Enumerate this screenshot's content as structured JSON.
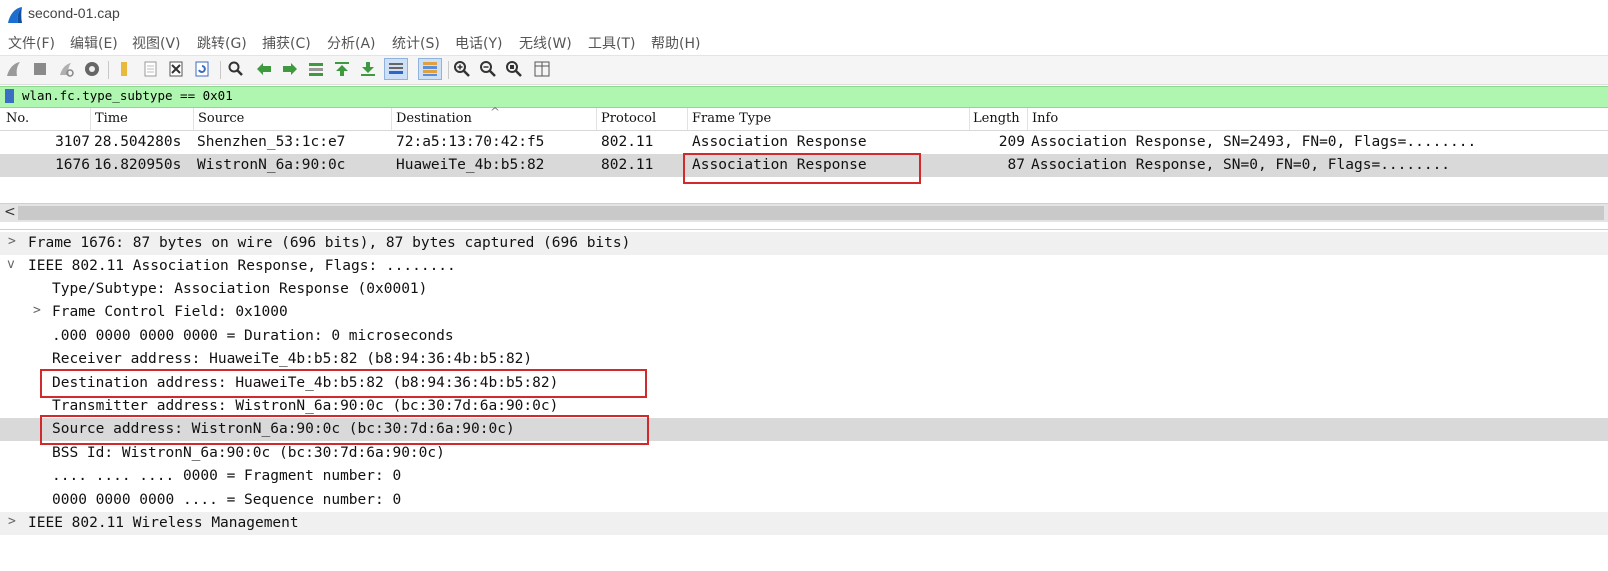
{
  "window": {
    "title": "second-01.cap"
  },
  "menu": [
    "文件(F)",
    "编辑(E)",
    "视图(V)",
    "跳转(G)",
    "捕获(C)",
    "分析(A)",
    "统计(S)",
    "电话(Y)",
    "无线(W)",
    "工具(T)",
    "帮助(H)"
  ],
  "toolbar": {
    "buttons": [
      "start-capture-icon",
      "stop-capture-icon",
      "restart-capture-icon",
      "capture-options-icon",
      "open-file-icon",
      "save-file-icon",
      "close-file-icon",
      "reload-file-icon",
      "find-packet-icon",
      "go-back-icon",
      "go-forward-icon",
      "go-to-packet-icon",
      "go-first-icon",
      "go-last-icon",
      "autoscroll-icon",
      "colorize-icon",
      "zoom-in-icon",
      "zoom-out-icon",
      "zoom-reset-icon",
      "resize-columns-icon"
    ]
  },
  "filter": {
    "value": "wlan.fc.type_subtype == 0x01"
  },
  "packet_list": {
    "columns": [
      "No.",
      "Time",
      "Source",
      "Destination",
      "Protocol",
      "Frame Type",
      "Length",
      "Info"
    ],
    "sort_indicator": "^",
    "rows": [
      {
        "no": "3107",
        "time": "28.504280s",
        "source": "Shenzhen_53:1c:e7",
        "destination": "72:a5:13:70:42:f5",
        "protocol": "802.11",
        "frame_type": "Association Response",
        "length": "209",
        "info": "Association Response, SN=2493, FN=0, Flags=........"
      },
      {
        "no": "1676",
        "time": "16.820950s",
        "source": "WistronN_6a:90:0c",
        "destination": "HuaweiTe_4b:b5:82",
        "protocol": "802.11",
        "frame_type": "Association Response",
        "length": "87",
        "info": "Association Response, SN=0, FN=0, Flags=........"
      }
    ],
    "selected_index": 1
  },
  "scroll": {
    "left_arrow": "<"
  },
  "details": {
    "rows": [
      {
        "indent": 0,
        "expander": ">",
        "text": "Frame 1676: 87 bytes on wire (696 bits), 87 bytes captured (696 bits)"
      },
      {
        "indent": 0,
        "expander": "v",
        "text": "IEEE 802.11 Association Response, Flags: ........"
      },
      {
        "indent": 1,
        "expander": "",
        "text": "Type/Subtype: Association Response (0x0001)"
      },
      {
        "indent": 1,
        "expander": ">",
        "text": "Frame Control Field: 0x1000"
      },
      {
        "indent": 1,
        "expander": "",
        "text": ".000 0000 0000 0000 = Duration: 0 microseconds"
      },
      {
        "indent": 1,
        "expander": "",
        "text": "Receiver address: HuaweiTe_4b:b5:82 (b8:94:36:4b:b5:82)"
      },
      {
        "indent": 1,
        "expander": "",
        "text": "Destination address: HuaweiTe_4b:b5:82 (b8:94:36:4b:b5:82)"
      },
      {
        "indent": 1,
        "expander": "",
        "text": "Transmitter address: WistronN_6a:90:0c (bc:30:7d:6a:90:0c)"
      },
      {
        "indent": 1,
        "expander": "",
        "text": "Source address: WistronN_6a:90:0c (bc:30:7d:6a:90:0c)"
      },
      {
        "indent": 1,
        "expander": "",
        "text": "BSS Id: WistronN_6a:90:0c (bc:30:7d:6a:90:0c)"
      },
      {
        "indent": 1,
        "expander": "",
        "text": ".... .... .... 0000 = Fragment number: 0"
      },
      {
        "indent": 1,
        "expander": "",
        "text": "0000 0000 0000 .... = Sequence number: 0"
      },
      {
        "indent": 0,
        "expander": ">",
        "text": "IEEE 802.11 Wireless Management"
      }
    ],
    "selected_index": 8
  },
  "colors": {
    "filter_valid_bg": "#aff7b0",
    "selected_row_bg": "#d9d9d9",
    "annotation_red": "#d22a2a"
  }
}
